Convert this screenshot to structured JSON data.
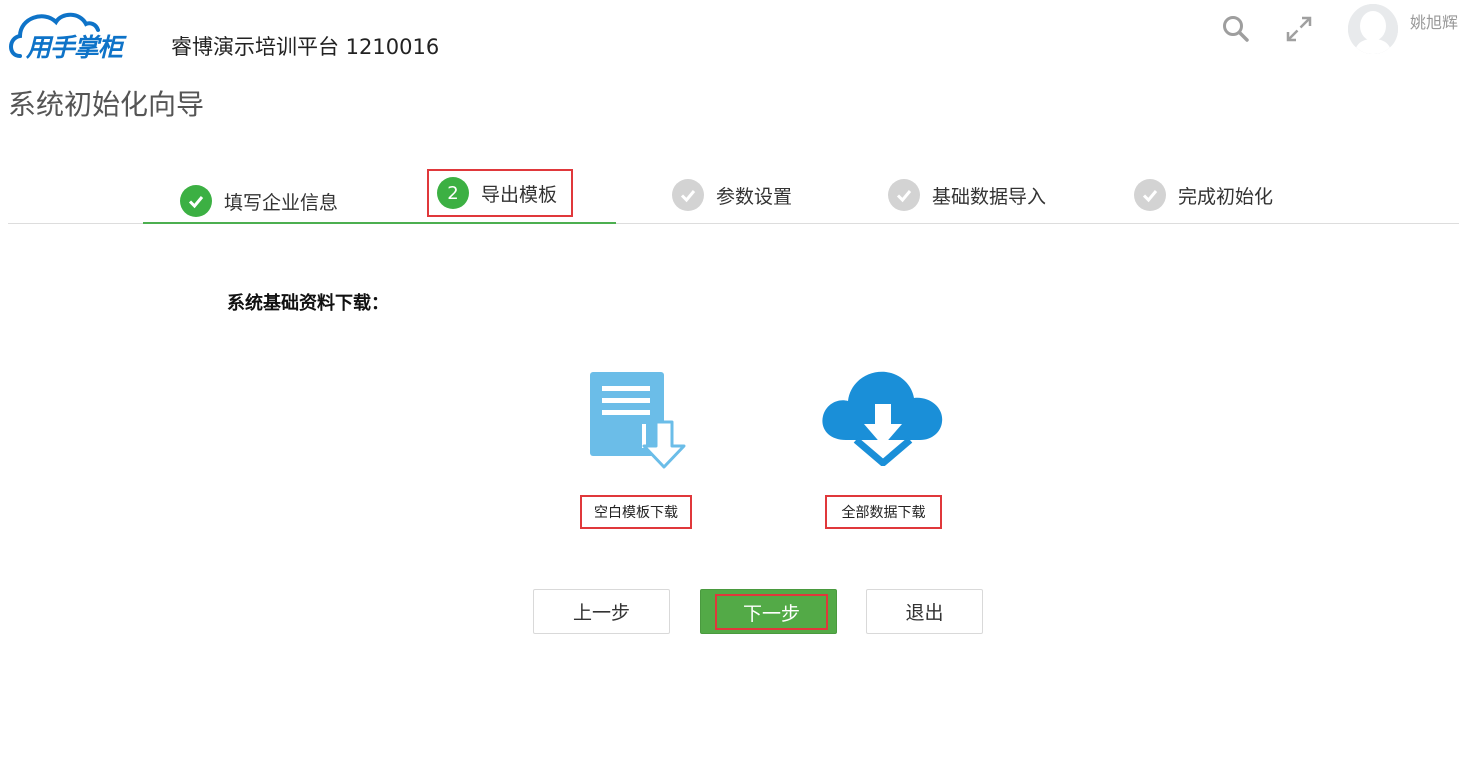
{
  "header": {
    "logo_text": "用手掌柜",
    "platform_name": "睿博演示培训平台  1210016",
    "username": "姚旭辉",
    "icons": [
      "search-icon",
      "expand-icon",
      "avatar"
    ]
  },
  "page_title": "系统初始化向导",
  "steps": [
    {
      "index": "1",
      "label": "填写企业信息",
      "status": "done"
    },
    {
      "index": "2",
      "label": "导出模板",
      "status": "current"
    },
    {
      "index": "3",
      "label": "参数设置",
      "status": "todo"
    },
    {
      "index": "4",
      "label": "基础数据导入",
      "status": "todo"
    },
    {
      "index": "5",
      "label": "完成初始化",
      "status": "todo"
    }
  ],
  "content": {
    "section_title": "系统基础资料下载：",
    "downloads": [
      {
        "label": "空白模板下载",
        "icon": "document-download-icon"
      },
      {
        "label": "全部数据下载",
        "icon": "cloud-download-icon"
      }
    ]
  },
  "buttons": {
    "prev": "上一步",
    "next": "下一步",
    "exit": "退出"
  },
  "colors": {
    "accent_green": "#3cb043",
    "button_green": "#53aa47",
    "highlight_red": "#e0383b",
    "logo_blue": "#0e73c8",
    "doc_blue": "#6bbde8",
    "cloud_blue": "#1a8fd8",
    "inactive_gray": "#d3d3d3"
  }
}
